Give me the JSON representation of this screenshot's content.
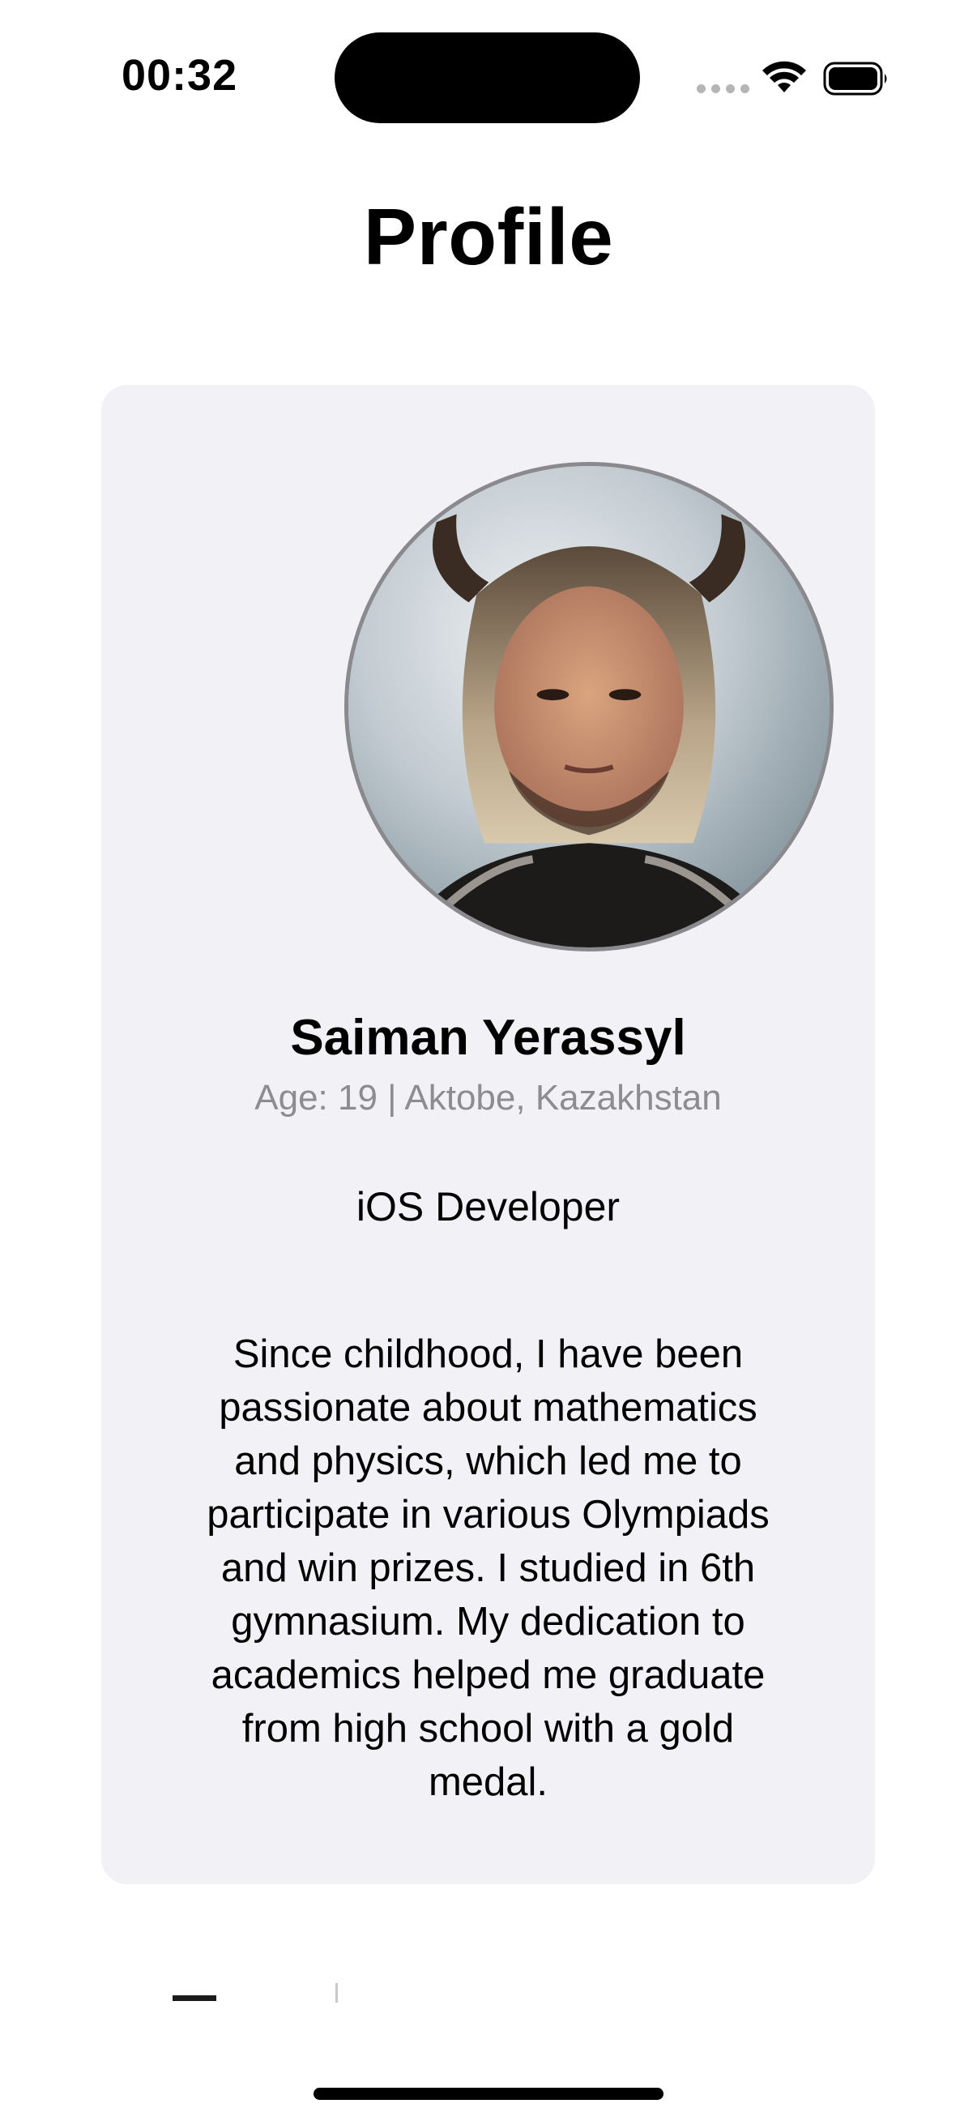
{
  "status_bar": {
    "time": "00:32"
  },
  "header": {
    "title": "Profile"
  },
  "profile": {
    "name": "Saiman Yerassyl",
    "meta": "Age: 19 | Aktobe, Kazakhstan",
    "role": "iOS Developer",
    "bio": "Since childhood, I have been passionate about mathematics and physics, which led me to participate in various Olympiads and win prizes. I studied in 6th gymnasium. My dedication to academics helped me graduate from high school with a gold medal."
  },
  "colors": {
    "card_background": "#f2f1f6",
    "secondary_text": "#8c8c91",
    "avatar_border": "#8a8a8e"
  },
  "icons": [
    "wifi-icon",
    "battery-icon",
    "signal-dots-icon"
  ]
}
